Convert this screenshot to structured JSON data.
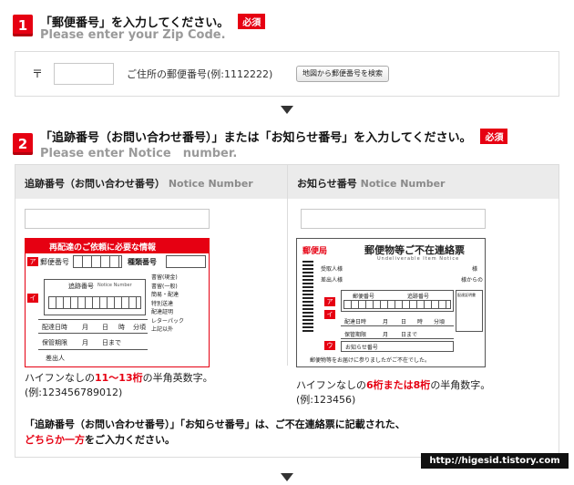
{
  "step1": {
    "number": "1",
    "title": "「郵便番号」を入力してください。",
    "required": "必須",
    "subtitle": "Please enter your Zip Code.",
    "zip_mark": "〒",
    "zip_value": "",
    "zip_label": "ご住所の郵便番号(例:1112222)",
    "map_button": "地図から郵便番号を検索"
  },
  "step2": {
    "number": "2",
    "title": "「追跡番号（お問い合わせ番号）」または「お知らせ番号」を入力してください。",
    "required": "必須",
    "subtitle": "Please enter Notice　number."
  },
  "tracking": {
    "header_jp": "追跡番号（お問い合わせ番号）",
    "header_en": "Notice Number",
    "value": "",
    "desc_pre": "ハイフンなしの",
    "desc_red": "11〜13桁",
    "desc_post": "の半角英数字。",
    "example": "(例:123456789012)",
    "card": {
      "title": "再配達のご依頼に必要な情報",
      "row_label": "郵便番号",
      "type_label": "種類番号",
      "tracking_label": "追跡番号",
      "notice_label": "Notice Number",
      "date_label": "配達日時",
      "month": "月",
      "day": "日",
      "hour": "時",
      "minute": "分頃",
      "keep_label": "保管期限",
      "until": "日まで",
      "sender_label": "差出人",
      "items": [
        "書留(現金)",
        "書留(一般)",
        "簡易・配達",
        "特別送達",
        "配達証明",
        "レターパック",
        "上記以外"
      ]
    }
  },
  "notice": {
    "header_jp": "お知らせ番号",
    "header_en": "Notice Number",
    "value": "",
    "desc_pre": "ハイフンなしの",
    "desc_red": "6桁または8桁",
    "desc_post": "の半角数字。",
    "example": "(例:123456)",
    "card": {
      "logo": "郵便局",
      "title": "郵便物等ご不在連絡票",
      "subtitle": "Undeliverable Item Notice",
      "addressee": "受取人様",
      "sender": "差出人様",
      "sama": "様",
      "from": "様からの",
      "zip_label": "郵便番号",
      "tracking_label": "追跡番号",
      "date_label": "配達日時",
      "month": "月",
      "day": "日",
      "hour": "時",
      "minute": "分頃",
      "keep_label": "保管期限",
      "until": "日まで",
      "notice_label": "お知らせ番号",
      "delivery_label": "配達証明書",
      "footer": "郵便物等をお届けに参りましたがご不在でした。"
    }
  },
  "bottom_note": {
    "line1": "「追跡番号（お問い合わせ番号）」「お知らせ番号」は、ご不在連絡票に記載された、",
    "line2_red": "どちらか一方",
    "line2_post": "をご入力ください。"
  },
  "watermark": "http://higesid.tistory.com",
  "colors": {
    "accent": "#e60012",
    "header_bg": "#ebebeb",
    "muted": "#9a9a9a"
  }
}
